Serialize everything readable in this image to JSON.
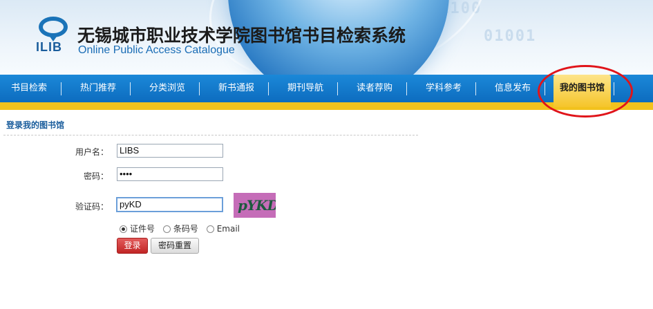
{
  "header": {
    "logo_text": "ILIB",
    "title_cn": "无锡城市职业技术学院图书馆书目检索系统",
    "title_en": "Online Public Access Catalogue"
  },
  "nav": {
    "items": [
      "书目检索",
      "热门推荐",
      "分类浏览",
      "新书通报",
      "期刊导航",
      "读者荐购",
      "学科参考",
      "信息发布",
      "我的图书馆"
    ],
    "active_index": 8
  },
  "login": {
    "section_title": "登录我的图书馆",
    "username_label": "用户名：",
    "username_value": "LIBS",
    "password_label": "密码：",
    "password_value": "••••",
    "captcha_label": "验证码：",
    "captcha_value": "pyKD",
    "captcha_image_text": "pYKD",
    "radio_options": [
      "证件号",
      "条码号",
      "Email"
    ],
    "radio_selected": 0,
    "login_button": "登录",
    "reset_button": "密码重置"
  },
  "colors": {
    "nav_bg": "#0d6cbf",
    "nav_strip": "#f2c21d",
    "active_tab": "#f5c52a",
    "annotation": "#e0141a",
    "login_button": "#c12525"
  }
}
